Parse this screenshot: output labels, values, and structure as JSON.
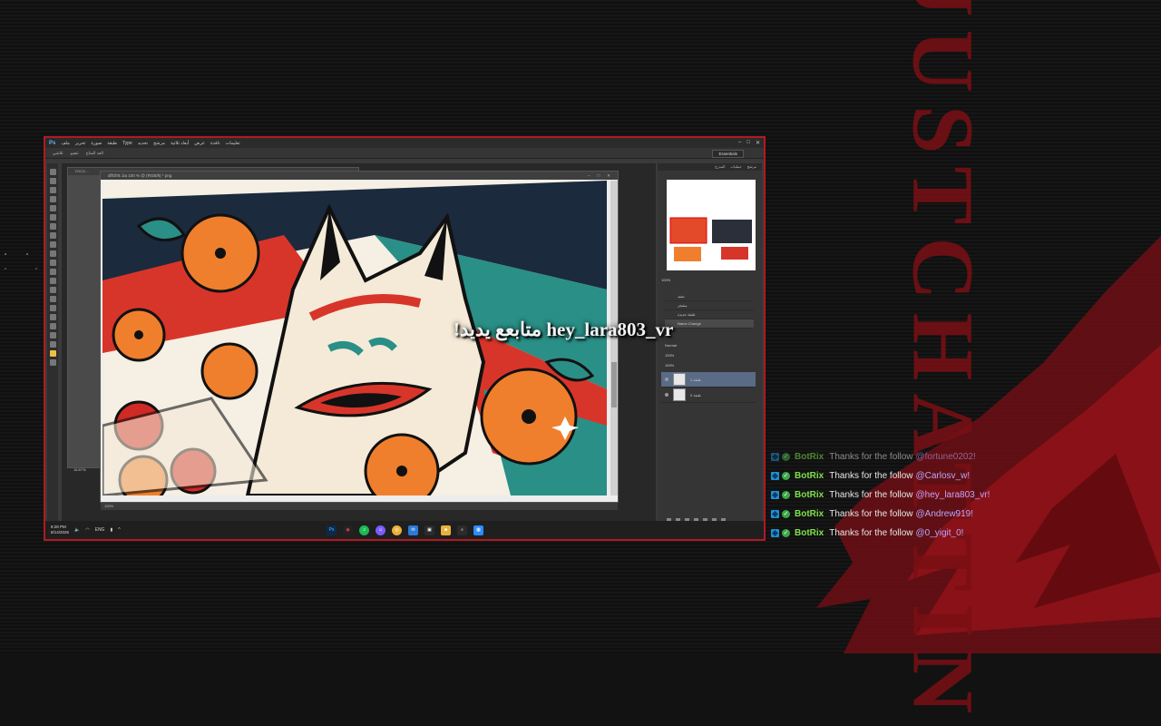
{
  "overlay": {
    "side_title": "JUSTCHATTIN",
    "alert_text": "!متابعع يديد hey_lara803_vr"
  },
  "photoshop": {
    "logo": "Ps",
    "menu": [
      "ملف",
      "تحرير",
      "صورة",
      "طبقة",
      "Type",
      "تحديد",
      "مرشح",
      "أبعاد ثلاثية",
      "عرض",
      "نافذة",
      "تعليمات"
    ],
    "window_controls": [
      "–",
      "□",
      "✕"
    ],
    "options_bar": [
      "تلاشي",
      "تنعيم",
      "العد المتاح",
      "Essentials"
    ],
    "back_doc_tab": "DSC8 ...",
    "back_doc_zoom": "16.67%",
    "front_doc_tab": "dlfGfr8..ba 100 % @ (RGB/8) * png",
    "front_doc_status": "100%",
    "panel_tabs": [
      "المدرج",
      "عمليات",
      "مرشح"
    ],
    "nav_zoom": "100%",
    "panel_rows": [
      "تنفيذ",
      "مشجر",
      "طبقة جديدة",
      "Name Change"
    ],
    "layer_controls": [
      "Normal",
      "100%",
      "100%"
    ],
    "layers": [
      "طبقة 1",
      "طبقة 0"
    ]
  },
  "taskbar": {
    "time": "8:28 PM",
    "date": "8/14/2026",
    "lang": "ENG",
    "apps": [
      "Ps",
      "◉",
      "♫",
      "☺",
      "◎",
      "✉",
      "▣",
      "■",
      "⌕",
      "▦"
    ]
  },
  "chat": [
    {
      "user": "BotRix",
      "msg": "Thanks for the follow",
      "mention": "@fortune0202!",
      "faded": true
    },
    {
      "user": "BotRix",
      "msg": "Thanks for the follow",
      "mention": "@Carlosv_w!",
      "faded": false
    },
    {
      "user": "BotRix",
      "msg": "Thanks for the follow",
      "mention": "@hey_lara803_vr!",
      "faded": false
    },
    {
      "user": "BotRix",
      "msg": "Thanks for the follow",
      "mention": "@Andrew919!",
      "faded": false
    },
    {
      "user": "BotRix",
      "msg": "Thanks for the follow",
      "mention": "@0_yigit_0!",
      "faded": false
    }
  ]
}
